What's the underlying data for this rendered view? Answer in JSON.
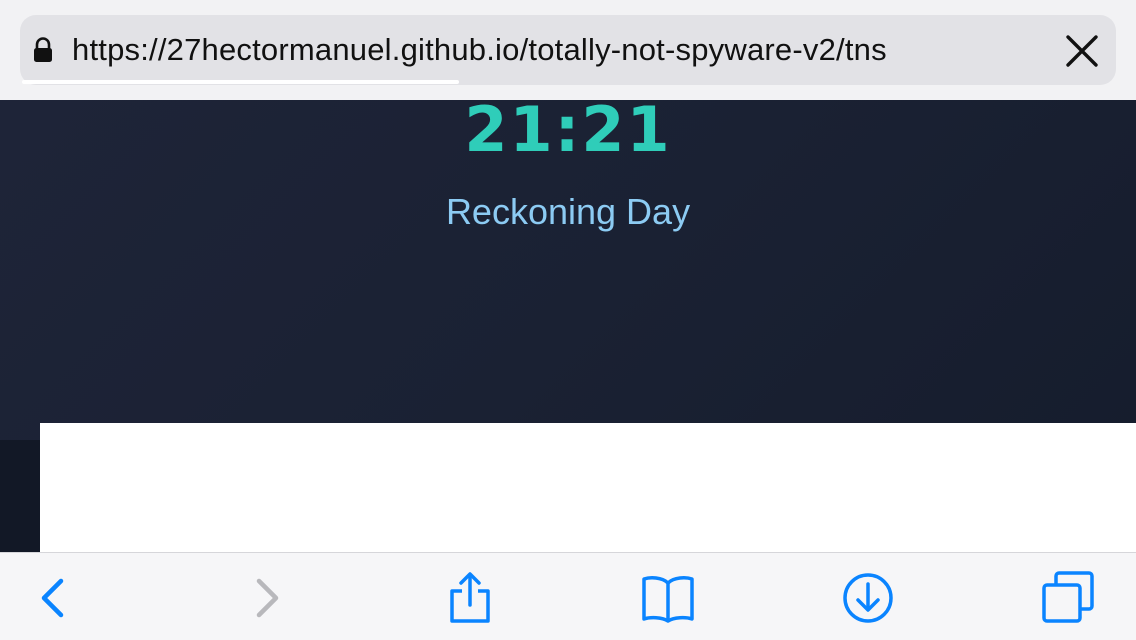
{
  "address_bar": {
    "url": "https://27hectormanuel.github.io/totally-not-spyware-v2/tns",
    "lock_icon": "lock-icon",
    "close_icon": "close-icon",
    "load_progress": 0.4
  },
  "page": {
    "clock": "21:21",
    "subtitle": "Reckoning Day"
  },
  "toolbar": {
    "items": [
      {
        "name": "back",
        "icon": "chevron-left-icon",
        "enabled": true
      },
      {
        "name": "forward",
        "icon": "chevron-right-icon",
        "enabled": false
      },
      {
        "name": "share",
        "icon": "share-icon",
        "enabled": true
      },
      {
        "name": "bookmarks",
        "icon": "book-icon",
        "enabled": true
      },
      {
        "name": "downloads",
        "icon": "download-icon",
        "enabled": true
      },
      {
        "name": "tabs",
        "icon": "tabs-icon",
        "enabled": true
      }
    ]
  },
  "colors": {
    "accent_blue": "#0a84ff",
    "disabled_gray": "#b8b8bc",
    "clock_teal": "#2fcdb9",
    "subtitle_blue": "#8ccbf3",
    "page_bg": "#1a2133"
  }
}
